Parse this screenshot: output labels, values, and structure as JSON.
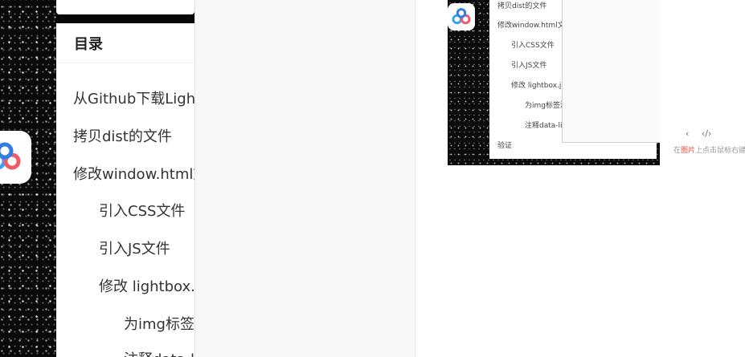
{
  "toc": {
    "title": "目录",
    "items": [
      {
        "label": "从Github下载Lightbox"
      },
      {
        "label": "拷贝dist的文件"
      },
      {
        "label": "修改window.html文件"
      },
      {
        "label": "引入CSS文件"
      },
      {
        "label": "引入JS文件"
      },
      {
        "label": "修改 lightbox.js"
      },
      {
        "label": "为img标签添加"
      },
      {
        "label": "注释data-lightbox"
      }
    ]
  },
  "preview": {
    "toc_items": [
      {
        "label": "拷贝dist的文件"
      },
      {
        "label": "修改window.html文件"
      },
      {
        "label": "引入CSS文件"
      },
      {
        "label": "引入JS文件"
      },
      {
        "label": "修改 lightbox.js"
      },
      {
        "label": "为img标签添加"
      },
      {
        "label": "注释data-lightbox"
      },
      {
        "label": "验证"
      }
    ],
    "toolbar": {
      "prev": "‹",
      "code": "‹/›"
    },
    "caption_prefix": "在",
    "caption_highlight": "图片",
    "caption_suffix": "上点击鼠标右键"
  },
  "colors": {
    "accent": "#e44444",
    "badge_blue": "#3aa0f0",
    "badge_red": "#f05a6a"
  },
  "icons": {
    "app": "baidu-netdisk-icon"
  }
}
